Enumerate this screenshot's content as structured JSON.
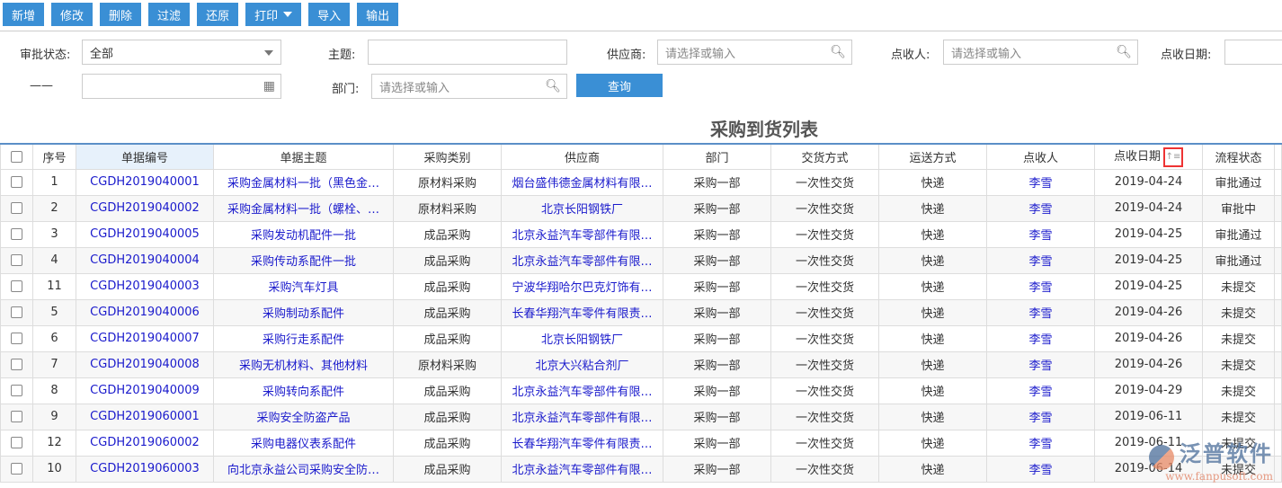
{
  "toolbar": {
    "add": "新增",
    "edit": "修改",
    "delete": "删除",
    "filter": "过滤",
    "restore": "还原",
    "print": "打印",
    "import": "导入",
    "export": "输出"
  },
  "filters": {
    "status_label": "审批状态:",
    "status_value": "全部",
    "subject_label": "主题:",
    "supplier_label": "供应商:",
    "supplier_placeholder": "请选择或输入",
    "receiver_label": "点收人:",
    "receiver_placeholder": "请选择或输入",
    "date_label": "点收日期:",
    "range_sep": "——",
    "dept_label": "部门:",
    "dept_placeholder": "请选择或输入",
    "query": "查询"
  },
  "table": {
    "title": "采购到货列表",
    "headers": [
      "序号",
      "单据编号",
      "单据主题",
      "采购类别",
      "供应商",
      "部门",
      "交货方式",
      "运送方式",
      "点收人",
      "点收日期",
      "流程状态"
    ],
    "sort_icon": "↑≡",
    "rows": [
      [
        "1",
        "CGDH2019040001",
        "采购金属材料一批（黑色金…",
        "原材料采购",
        "烟台盛伟德金属材料有限…",
        "采购一部",
        "一次性交货",
        "快递",
        "李雪",
        "2019-04-24",
        "审批通过"
      ],
      [
        "2",
        "CGDH2019040002",
        "采购金属材料一批（螺栓、…",
        "原材料采购",
        "北京长阳钢铁厂",
        "采购一部",
        "一次性交货",
        "快递",
        "李雪",
        "2019-04-24",
        "审批中"
      ],
      [
        "3",
        "CGDH2019040005",
        "采购发动机配件一批",
        "成品采购",
        "北京永益汽车零部件有限…",
        "采购一部",
        "一次性交货",
        "快递",
        "李雪",
        "2019-04-25",
        "审批通过"
      ],
      [
        "4",
        "CGDH2019040004",
        "采购传动系配件一批",
        "成品采购",
        "北京永益汽车零部件有限…",
        "采购一部",
        "一次性交货",
        "快递",
        "李雪",
        "2019-04-25",
        "审批通过"
      ],
      [
        "11",
        "CGDH2019040003",
        "采购汽车灯具",
        "成品采购",
        "宁波华翔哈尔巴克灯饰有…",
        "采购一部",
        "一次性交货",
        "快递",
        "李雪",
        "2019-04-25",
        "未提交"
      ],
      [
        "5",
        "CGDH2019040006",
        "采购制动系配件",
        "成品采购",
        "长春华翔汽车零件有限责…",
        "采购一部",
        "一次性交货",
        "快递",
        "李雪",
        "2019-04-26",
        "未提交"
      ],
      [
        "6",
        "CGDH2019040007",
        "采购行走系配件",
        "成品采购",
        "北京长阳钢铁厂",
        "采购一部",
        "一次性交货",
        "快递",
        "李雪",
        "2019-04-26",
        "未提交"
      ],
      [
        "7",
        "CGDH2019040008",
        "采购无机材料、其他材料",
        "原材料采购",
        "北京大兴粘合剂厂",
        "采购一部",
        "一次性交货",
        "快递",
        "李雪",
        "2019-04-26",
        "未提交"
      ],
      [
        "8",
        "CGDH2019040009",
        "采购转向系配件",
        "成品采购",
        "北京永益汽车零部件有限…",
        "采购一部",
        "一次性交货",
        "快递",
        "李雪",
        "2019-04-29",
        "未提交"
      ],
      [
        "9",
        "CGDH2019060001",
        "采购安全防盗产品",
        "成品采购",
        "北京永益汽车零部件有限…",
        "采购一部",
        "一次性交货",
        "快递",
        "李雪",
        "2019-06-11",
        "未提交"
      ],
      [
        "12",
        "CGDH2019060002",
        "采购电器仪表系配件",
        "成品采购",
        "长春华翔汽车零件有限责…",
        "采购一部",
        "一次性交货",
        "快递",
        "李雪",
        "2019-06-11",
        "未提交"
      ],
      [
        "10",
        "CGDH2019060003",
        "向北京永益公司采购安全防…",
        "成品采购",
        "北京永益汽车零部件有限…",
        "采购一部",
        "一次性交货",
        "快递",
        "李雪",
        "2019-06-14",
        "未提交"
      ]
    ]
  },
  "watermark": {
    "brand": "泛普软件",
    "url": "www.fanpusoft.com"
  }
}
